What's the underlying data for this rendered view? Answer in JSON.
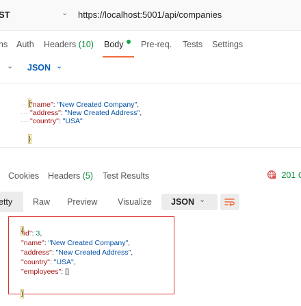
{
  "urlbar": {
    "method": "ST",
    "chevron": "⌄",
    "url": "https://localhost:5001/api/companies"
  },
  "request_tabs": {
    "params": "ns",
    "auth": "Auth",
    "headers": "Headers",
    "headers_count": "(10)",
    "body": "Body",
    "prereq": "Pre-req.",
    "tests": "Tests",
    "settings": "Settings"
  },
  "body_type": {
    "chevron": "⌄",
    "format": "JSON",
    "format_chevron": "⌄"
  },
  "request_body": {
    "open": "{",
    "close": "}",
    "lines": [
      {
        "key": "\"name\"",
        "value": "\"New Created Company\"",
        "tail": ","
      },
      {
        "key": "\"address\"",
        "value": "\"New Created Address\"",
        "tail": ","
      },
      {
        "key": "\"country\"",
        "value": "\"USA\"",
        "tail": ""
      }
    ]
  },
  "response_tabs": {
    "cookies": "Cookies",
    "headers": "Headers",
    "headers_count": "(5)",
    "test_results": "Test Results",
    "status": "201 C"
  },
  "response_toolbar": {
    "pretty": "etty",
    "raw": "Raw",
    "preview": "Preview",
    "visualize": "Visualize",
    "format": "JSON",
    "format_chevron": "⌄"
  },
  "response_body": {
    "open": "{",
    "close": "}",
    "lines": [
      {
        "key": "\"id\"",
        "value": "3",
        "type": "num",
        "tail": ","
      },
      {
        "key": "\"name\"",
        "value": "\"New Created Company\"",
        "type": "str",
        "tail": ","
      },
      {
        "key": "\"address\"",
        "value": "\"New Created Address\"",
        "type": "str",
        "tail": ","
      },
      {
        "key": "\"country\"",
        "value": "\"USA\"",
        "type": "str",
        "tail": ","
      },
      {
        "key": "\"employees\"",
        "value": "[]",
        "type": "punc",
        "tail": ""
      }
    ]
  },
  "colors": {
    "accent_tab": "#f26b3a",
    "success": "#0d8a3a",
    "highlight_box": "#e0312f",
    "link_blue": "#0b5fb3"
  }
}
